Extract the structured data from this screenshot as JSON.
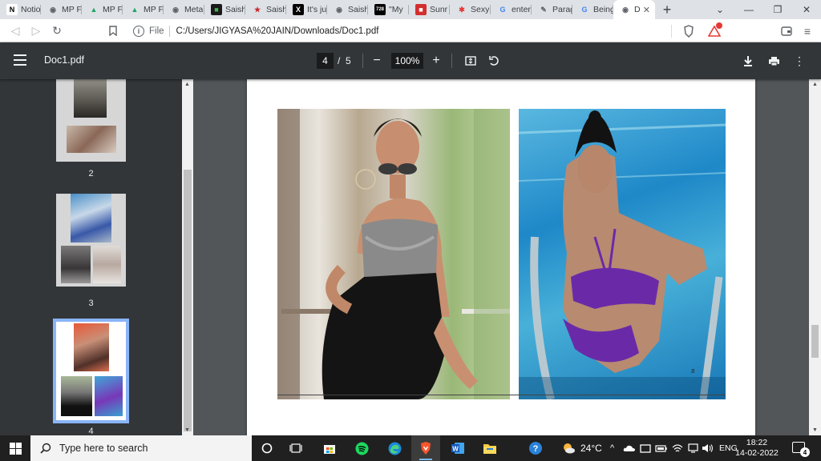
{
  "browser": {
    "tabs": [
      {
        "title": "Notio",
        "icon": "notion-icon",
        "fav_text": "N",
        "fav_bg": "#ffffff",
        "fav_fg": "#000000"
      },
      {
        "title": "MP F",
        "icon": "globe-icon",
        "fav_text": "◉",
        "fav_bg": "#dee1e6",
        "fav_fg": "#5f6368"
      },
      {
        "title": "MP F",
        "icon": "google-drive-icon",
        "fav_text": "▲",
        "fav_bg": "#dee1e6",
        "fav_fg": "#1fa463"
      },
      {
        "title": "MP F",
        "icon": "google-drive-icon",
        "fav_text": "▲",
        "fav_bg": "#dee1e6",
        "fav_fg": "#1fa463"
      },
      {
        "title": "Meta",
        "icon": "globe-icon",
        "fav_text": "◉",
        "fav_bg": "#dee1e6",
        "fav_fg": "#5f6368"
      },
      {
        "title": "Saish",
        "icon": "image-tab-icon",
        "fav_text": "■",
        "fav_bg": "#1a1a1a",
        "fav_fg": "#4caf50"
      },
      {
        "title": "Saish",
        "icon": "star-tab-icon",
        "fav_text": "★",
        "fav_bg": "#dee1e6",
        "fav_fg": "#c62828"
      },
      {
        "title": "It's ju",
        "icon": "x-tab-icon",
        "fav_text": "X",
        "fav_bg": "#000000",
        "fav_fg": "#ffffff"
      },
      {
        "title": "Saish",
        "icon": "globe-icon",
        "fav_text": "◉",
        "fav_bg": "#dee1e6",
        "fav_fg": "#5f6368"
      },
      {
        "title": "\"My",
        "icon": "number-tab-icon",
        "fav_text": "728",
        "fav_bg": "#000000",
        "fav_fg": "#ffffff"
      },
      {
        "title": "Sunr",
        "icon": "red-tab-icon",
        "fav_text": "■",
        "fav_bg": "#d32f2f",
        "fav_fg": "#ffffff"
      },
      {
        "title": "Sexy",
        "icon": "pinwheel-tab-icon",
        "fav_text": "✱",
        "fav_bg": "#dee1e6",
        "fav_fg": "#e53935"
      },
      {
        "title": "enter",
        "icon": "google-icon",
        "fav_text": "G",
        "fav_bg": "#dee1e6",
        "fav_fg": "#4285f4"
      },
      {
        "title": "Parag",
        "icon": "quill-tab-icon",
        "fav_text": "✎",
        "fav_bg": "#dee1e6",
        "fav_fg": "#5f6368"
      },
      {
        "title": "Being",
        "icon": "google-icon",
        "fav_text": "G",
        "fav_bg": "#dee1e6",
        "fav_fg": "#4285f4"
      },
      {
        "title": "D",
        "icon": "globe-icon",
        "fav_text": "◉",
        "fav_bg": "#ffffff",
        "fav_fg": "#5f6368",
        "active": true
      }
    ],
    "new_tab": "+",
    "address": {
      "scheme": "File",
      "url": "C:/Users/JIGYASA%20JAIN/Downloads/Doc1.pdf"
    }
  },
  "pdf": {
    "filename": "Doc1.pdf",
    "current_page": "4",
    "page_separator": "/",
    "total_pages": "5",
    "zoom": "100%",
    "thumbnails": [
      {
        "label": "2"
      },
      {
        "label": "3"
      },
      {
        "label": "4",
        "selected": true
      }
    ]
  },
  "taskbar": {
    "search_placeholder": "Type here to search",
    "weather": "24°C",
    "language": "ENG",
    "time": "18:22",
    "date": "14-02-2022",
    "notifications": "4"
  },
  "colors": {
    "chrome_tabstrip": "#dee1e6",
    "pdf_toolbar": "#323639",
    "pdf_background": "#525659",
    "thumb_selected": "#8ab4f8",
    "taskbar": "#202020"
  }
}
